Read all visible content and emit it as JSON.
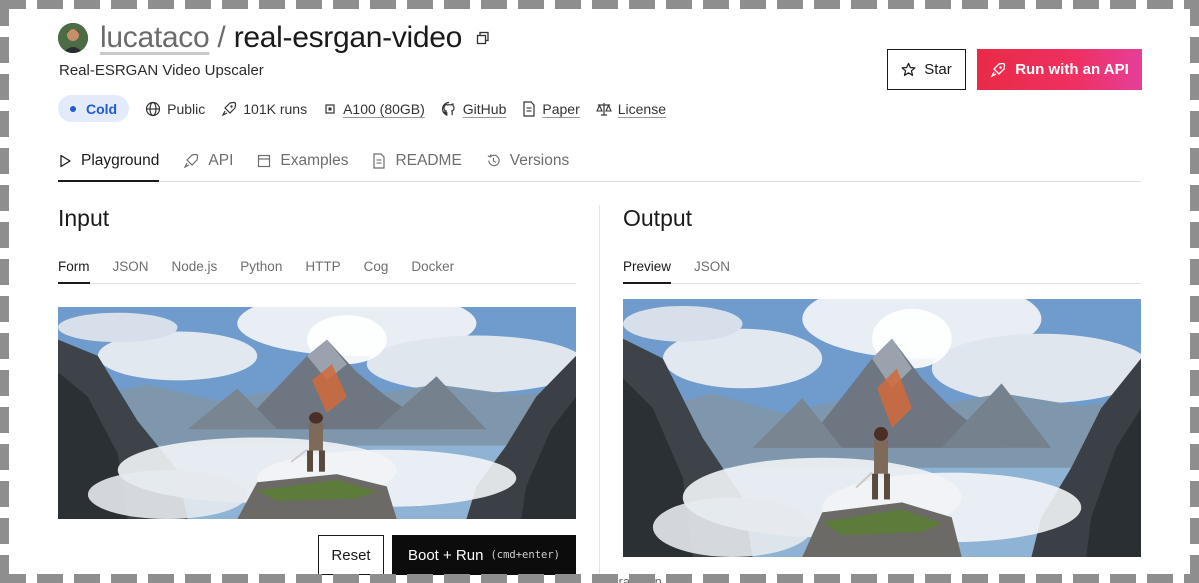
{
  "header": {
    "owner": "lucataco",
    "separator": "/",
    "model_name": "real-esrgan-video",
    "description": "Real-ESRGAN Video Upscaler",
    "avatar_icon": "user-avatar",
    "copy_icon": "copy-icon"
  },
  "meta": {
    "status": "Cold",
    "visibility": "Public",
    "runs": "101K runs",
    "hardware": "A100 (80GB)",
    "github": "GitHub",
    "paper": "Paper",
    "license": "License",
    "status_color": "#1f5bd6"
  },
  "actions": {
    "star_label": "Star",
    "run_api_label": "Run with an API",
    "accent": "#ea2a45"
  },
  "tabs": [
    {
      "label": "Playground",
      "icon": "play-icon",
      "active": true
    },
    {
      "label": "API",
      "icon": "rocket-icon",
      "active": false
    },
    {
      "label": "Examples",
      "icon": "image-icon",
      "active": false
    },
    {
      "label": "README",
      "icon": "document-icon",
      "active": false
    },
    {
      "label": "Versions",
      "icon": "history-icon",
      "active": false
    }
  ],
  "input": {
    "title": "Input",
    "subtabs": [
      "Form",
      "JSON",
      "Node.js",
      "Python",
      "HTTP",
      "Cog",
      "Docker"
    ],
    "active_subtab": "Form",
    "reset_label": "Reset",
    "run_label": "Boot + Run",
    "run_shortcut": "(cmd+enter)"
  },
  "output": {
    "title": "Output",
    "subtabs": [
      "Preview",
      "JSON"
    ],
    "active_subtab": "Preview",
    "footer_fragment": "...enerated in"
  }
}
